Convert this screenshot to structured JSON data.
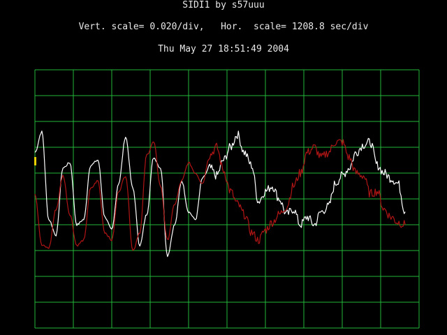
{
  "header": {
    "title": "SIDI1 by s57uuu",
    "scale_line": "Vert. scale= 0.020/div,   Hor.  scale= 1208.8 sec/div",
    "date": "Thu May 27 18:51:49 2004"
  },
  "colors": {
    "background": "#000000",
    "grid": "#22b83a",
    "trace_white": "#ffffff",
    "trace_red": "#b01515",
    "marker": "#e8d000",
    "text": "#e8e8e8"
  },
  "chart_data": {
    "type": "line",
    "title": "",
    "xlabel": "",
    "ylabel": "",
    "x_divisions": 10,
    "y_divisions": 10,
    "x_units_per_div": 1208.8,
    "y_units_per_div": 0.02,
    "xlim": [
      0,
      10
    ],
    "ylim": [
      -5,
      5
    ],
    "grid": true,
    "series": [
      {
        "color": "#ffffff",
        "x": [
          0.0,
          0.18,
          0.36,
          0.55,
          0.73,
          0.91,
          1.09,
          1.27,
          1.45,
          1.64,
          1.82,
          2.0,
          2.18,
          2.36,
          2.55,
          2.73,
          2.91,
          3.09,
          3.27,
          3.45,
          3.64,
          3.82,
          4.0,
          4.18,
          4.36,
          4.55,
          4.73,
          4.91,
          5.09,
          5.27,
          5.45,
          5.64,
          5.82,
          6.0,
          6.18,
          6.36,
          6.55,
          6.73,
          6.91,
          7.09,
          7.27,
          7.45,
          7.64,
          7.82,
          8.0,
          8.18,
          8.36,
          8.55,
          8.73,
          8.91,
          9.09,
          9.27,
          9.45,
          9.64
        ],
        "y": [
          1.8,
          2.6,
          -0.8,
          -1.4,
          1.2,
          1.4,
          -1.0,
          -0.8,
          1.3,
          1.5,
          -0.7,
          -1.2,
          0.6,
          2.4,
          0.4,
          -1.8,
          -0.6,
          1.6,
          1.2,
          -2.2,
          -1.0,
          0.7,
          -0.5,
          -0.8,
          0.8,
          1.2,
          0.9,
          1.5,
          2.0,
          2.5,
          1.8,
          1.3,
          -0.1,
          0.3,
          0.5,
          0.0,
          -0.6,
          -0.4,
          -1.0,
          -0.7,
          -1.0,
          -0.5,
          -0.3,
          0.6,
          0.9,
          1.2,
          1.8,
          2.1,
          2.2,
          1.3,
          1.0,
          0.8,
          0.6,
          -0.5
        ]
      },
      {
        "color": "#b01515",
        "x": [
          0.0,
          0.18,
          0.36,
          0.55,
          0.73,
          0.91,
          1.09,
          1.27,
          1.45,
          1.64,
          1.82,
          2.0,
          2.18,
          2.36,
          2.55,
          2.73,
          2.91,
          3.09,
          3.27,
          3.45,
          3.64,
          3.82,
          4.0,
          4.18,
          4.36,
          4.55,
          4.73,
          4.91,
          5.09,
          5.27,
          5.45,
          5.64,
          5.82,
          6.0,
          6.18,
          6.36,
          6.55,
          6.73,
          6.91,
          7.09,
          7.27,
          7.45,
          7.64,
          7.82,
          8.0,
          8.18,
          8.36,
          8.55,
          8.73,
          8.91,
          9.09,
          9.27,
          9.45,
          9.64
        ],
        "y": [
          0.2,
          -1.8,
          -1.9,
          -0.4,
          0.9,
          -0.6,
          -1.8,
          -1.6,
          0.4,
          0.7,
          -1.3,
          -1.6,
          0.3,
          0.9,
          -2.0,
          -1.3,
          1.7,
          2.2,
          0.5,
          -1.6,
          -0.2,
          0.7,
          1.4,
          1.0,
          0.6,
          1.7,
          2.0,
          1.1,
          0.3,
          -0.2,
          -0.6,
          -1.3,
          -1.6,
          -1.2,
          -0.9,
          -0.6,
          -0.3,
          0.5,
          1.0,
          1.8,
          2.0,
          1.6,
          1.8,
          2.2,
          2.2,
          1.6,
          1.0,
          0.9,
          0.2,
          0.3,
          -0.4,
          -0.7,
          -0.9,
          -1.0
        ]
      }
    ]
  }
}
